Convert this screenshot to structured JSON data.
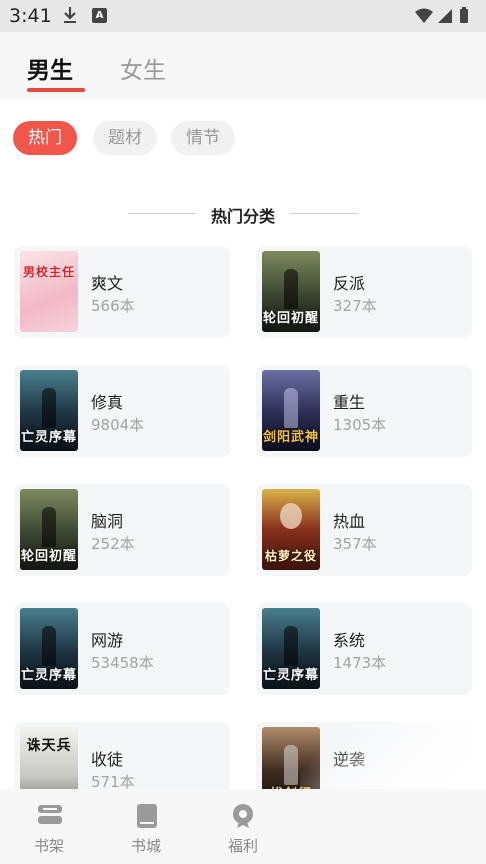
{
  "status": {
    "time": "3:41"
  },
  "tabs": {
    "male": "男生",
    "female": "女生"
  },
  "filters": [
    "热门",
    "题材",
    "情节"
  ],
  "section_title": "热门分类",
  "categories": [
    {
      "name": "爽文",
      "count": "566本",
      "cover_text": "男校主任"
    },
    {
      "name": "反派",
      "count": "327本",
      "cover_text": "轮回初醒"
    },
    {
      "name": "修真",
      "count": "9804本",
      "cover_text": "亡灵序幕"
    },
    {
      "name": "重生",
      "count": "1305本",
      "cover_text": "剑阳武神"
    },
    {
      "name": "脑洞",
      "count": "252本",
      "cover_text": "轮回初醒"
    },
    {
      "name": "热血",
      "count": "357本",
      "cover_text": "枯萝之役"
    },
    {
      "name": "网游",
      "count": "53458本",
      "cover_text": "亡灵序幕"
    },
    {
      "name": "系统",
      "count": "1473本",
      "cover_text": "亡灵序幕"
    },
    {
      "name": "收徒",
      "count": "571本",
      "cover_text": "诛天兵"
    },
    {
      "name": "逆袭",
      "count": "",
      "cover_text": "拔剑行"
    }
  ],
  "nav": {
    "shelf": "书架",
    "store": "书城",
    "welfare": "福利"
  },
  "colors": {
    "accent": "#e64a3d",
    "pill_active": "#f0564a",
    "card_bg": "#f5f6f8",
    "muted": "#a3a3a3"
  }
}
